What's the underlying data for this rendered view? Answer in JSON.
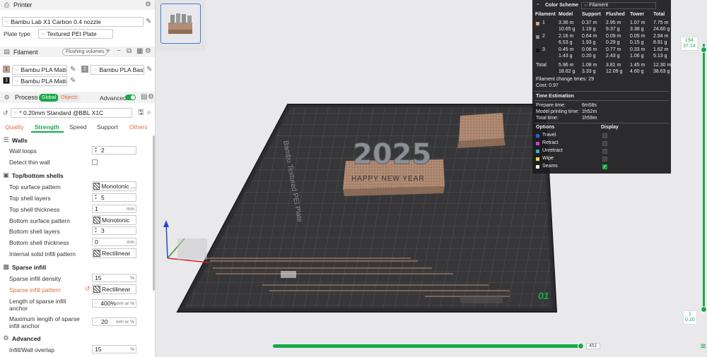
{
  "printer": {
    "section_title": "Printer",
    "name": "Bambu Lab X1 Carbon 0.4 nozzle",
    "plate_type_label": "Plate type",
    "plate_type": "Textured PEI Plate"
  },
  "filament": {
    "section_title": "Filament",
    "flushing_label": "Flushing volumes",
    "slots": [
      {
        "num": "1",
        "name": "Bambu PLA Matte",
        "color": "#c9a48f"
      },
      {
        "num": "2",
        "name": "Bambu PLA Basic",
        "color": "#8f8f8f"
      },
      {
        "num": "3",
        "name": "Bambu PLA Matte",
        "color": "#111111"
      }
    ]
  },
  "process": {
    "section_title": "Process",
    "global_label": "Global",
    "objects_label": "Objects",
    "advanced_label": "Advanced",
    "profile": "* 0.20mm Standard @BBL X1C",
    "tabs": [
      "Quality",
      "Strength",
      "Speed",
      "Support",
      "Others"
    ],
    "active_tab": "Strength"
  },
  "settings": {
    "walls_title": "Walls",
    "wall_loops_label": "Wall loops",
    "wall_loops": "2",
    "detect_thin_label": "Detect thin wall",
    "topbottom_title": "Top/bottom shells",
    "top_pattern_label": "Top surface pattern",
    "top_pattern": "Monotonic ...",
    "top_layers_label": "Top shell layers",
    "top_layers": "5",
    "top_thickness_label": "Top shell thickness",
    "top_thickness": "1",
    "bottom_pattern_label": "Bottom surface pattern",
    "bottom_pattern": "Monotonic",
    "bottom_layers_label": "Bottom shell layers",
    "bottom_layers": "3",
    "bottom_thickness_label": "Bottom shell thickness",
    "bottom_thickness": "0",
    "internal_infill_label": "Internal solid infill pattern",
    "internal_infill": "Rectilinear",
    "sparse_title": "Sparse infill",
    "density_label": "Sparse infill density",
    "density": "15",
    "sparse_pattern_label": "Sparse infill pattern",
    "sparse_pattern": "Rectilinear",
    "length_anchor_label_1": "Length of sparse infill",
    "length_anchor_label_2": "anchor",
    "length_anchor": "400%",
    "max_anchor_label_1": "Maximum length of sparse",
    "max_anchor_label_2": "infill anchor",
    "max_anchor": "20",
    "advanced_title": "Advanced",
    "overlap_label": "Infill/Wall overlap",
    "overlap": "15",
    "unit_mm": "mm",
    "unit_pct": "%",
    "unit_mm_or_pct": "mm or %"
  },
  "color_scheme": {
    "title": "Color Scheme",
    "mode": "Filament",
    "headers": [
      "Filament",
      "Model",
      "Support",
      "Flushed",
      "Tower",
      "Total"
    ],
    "rows": [
      {
        "id": "1",
        "color": "#c9a48f",
        "model": [
          "3.36 m",
          "10.65 g"
        ],
        "support": [
          "0.37 m",
          "1.19 g"
        ],
        "flushed": [
          "2.95 m",
          "9.37 g"
        ],
        "tower": [
          "1.07 m",
          "3.38 g"
        ],
        "total": [
          "7.75 m",
          "24.60 g"
        ]
      },
      {
        "id": "2",
        "color": "#8f8f8f",
        "model": [
          "2.16 m",
          "6.53 g"
        ],
        "support": [
          "0.64 m",
          "1.93 g"
        ],
        "flushed": [
          "0.09 m",
          "0.29 g"
        ],
        "tower": [
          "0.05 m",
          "0.15 g"
        ],
        "total": [
          "2.94 m",
          "8.91 g"
        ]
      },
      {
        "id": "3",
        "color": "#111111",
        "model": [
          "0.45 m",
          "1.43 g"
        ],
        "support": [
          "0.06 m",
          "0.20 g"
        ],
        "flushed": [
          "0.77 m",
          "2.43 g"
        ],
        "tower": [
          "0.33 m",
          "1.06 g"
        ],
        "total": [
          "1.62 m",
          "5.13 g"
        ]
      }
    ],
    "total_row": {
      "label": "Total",
      "model": [
        "5.96 m",
        "18.62 g"
      ],
      "support": [
        "1.08 m",
        "3.33 g"
      ],
      "flushed": [
        "3.81 m",
        "12.09 g"
      ],
      "tower": [
        "1.45 m",
        "4.60 g"
      ],
      "total": [
        "12.30 m",
        "38.63 g"
      ]
    },
    "change_times": "Filament change times:  29",
    "cost": "Cost:  0.97",
    "time_title": "Time Estimation",
    "prepare_label": "Prepare time:",
    "prepare": "6m58s",
    "model_time_label": "Model printing time:",
    "model_time": "1h52m",
    "total_time_label": "Total time:",
    "total_time": "1h59m",
    "options_label": "Options",
    "display_label": "Display",
    "options": [
      {
        "name": "Travel",
        "color": "#3a5bd9",
        "checked": false
      },
      {
        "name": "Retract",
        "color": "#c43fd6",
        "checked": false
      },
      {
        "name": "Unretract",
        "color": "#3fa5d6",
        "checked": false
      },
      {
        "name": "Wipe",
        "color": "#f2e233",
        "checked": false
      },
      {
        "name": "Seams",
        "color": "#f0f0f0",
        "checked": true
      }
    ]
  },
  "viewport": {
    "model_text": "2025",
    "banner_text": "HAPPY NEW YEAR",
    "plate_label": "Bambu Textured PEI Plate",
    "plate_number": "01"
  },
  "sliders": {
    "top_layer": "194",
    "top_height": "37.14",
    "bottom_layer": "1",
    "bottom_height": "0.20",
    "move_value": "451"
  }
}
